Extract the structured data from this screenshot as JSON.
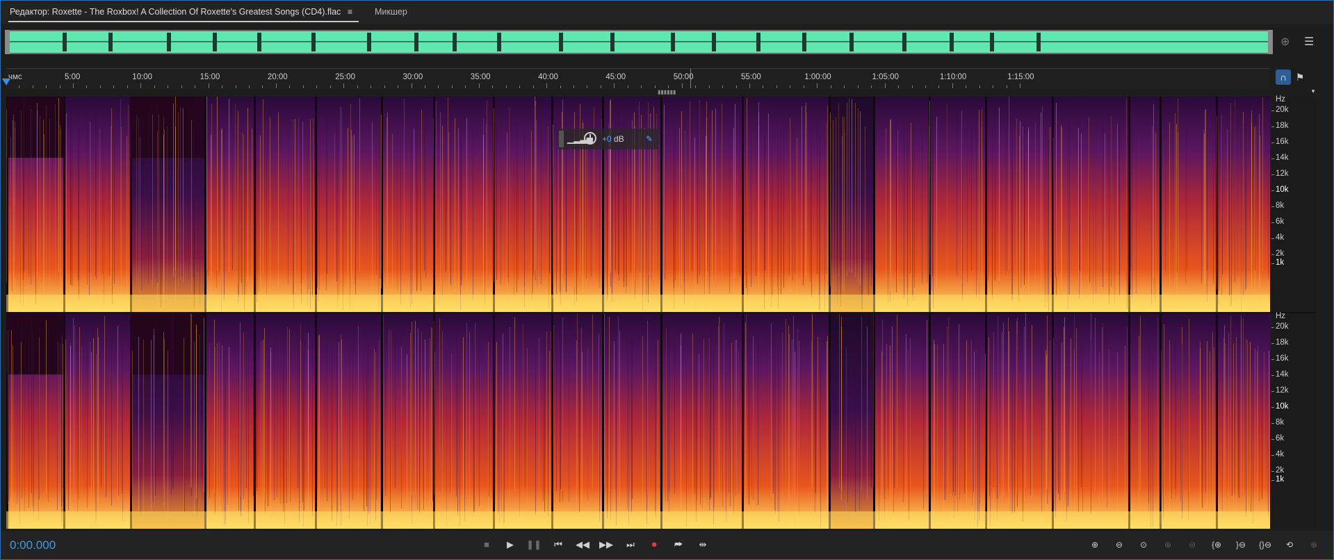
{
  "tabs": {
    "editor_label": "Редактор: Roxette - The Roxbox! A Collection Of Roxette's Greatest Songs (CD4).flac",
    "menu_icon": "≡",
    "mixer_label": "Микшер"
  },
  "colors": {
    "overview_wave": "#5fe8b0",
    "accent": "#3d9be9",
    "record": "#e6373a"
  },
  "ruler": {
    "unit_label": "чмс",
    "ticks": [
      "5:00",
      "10:00",
      "15:00",
      "20:00",
      "25:00",
      "30:00",
      "35:00",
      "40:00",
      "45:00",
      "50:00",
      "55:00",
      "1:00:00",
      "1:05:00",
      "1:10:00",
      "1:15:00"
    ]
  },
  "hz_axis": {
    "unit": "Hz",
    "labels": [
      "20k",
      "18k",
      "16k",
      "14k",
      "12k",
      "10k",
      "8k",
      "6k",
      "4k",
      "2k",
      "1k"
    ]
  },
  "hud": {
    "db_value": "+0",
    "db_unit": "dB"
  },
  "transport": {
    "time": "0:00.000",
    "buttons": [
      "stop",
      "play",
      "pause",
      "go-to-start",
      "rewind",
      "fast-forward",
      "go-to-end",
      "record",
      "loop",
      "skip-selection"
    ]
  },
  "zoom": {
    "buttons": [
      "zoom-in-amplitude",
      "zoom-out-amplitude",
      "zoom-reset",
      "zoom-in-frequency",
      "zoom-out-frequency",
      "zoom-in-time",
      "zoom-out-time",
      "zoom-out-full",
      "zoom-selection",
      "zoom-in-region",
      "zoom-to-selection"
    ]
  }
}
